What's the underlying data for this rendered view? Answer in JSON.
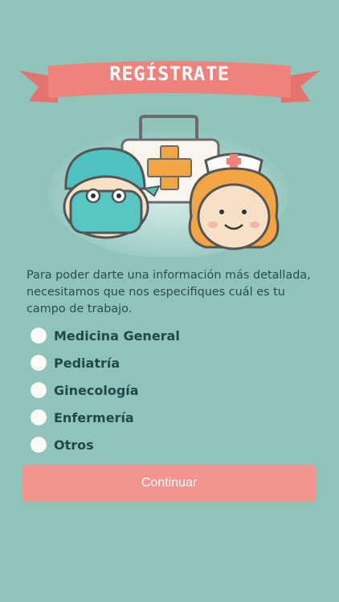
{
  "header": {
    "title": "REGÍSTRATE"
  },
  "intro_text": "Para poder darte una información más detallada, necesitamos que nos especifiques cuál es tu campo de trabajo.",
  "options": [
    {
      "label": "Medicina General"
    },
    {
      "label": "Pediatría"
    },
    {
      "label": "Ginecología"
    },
    {
      "label": "Enfermería"
    },
    {
      "label": "Otros"
    }
  ],
  "continue_button": {
    "label": "Continuar"
  },
  "colors": {
    "background": "#8fc4bb",
    "banner": "#f0827d",
    "button": "#f2958d",
    "text": "#2b4b53"
  },
  "icons": {
    "illustration": "medical-staff-illustration",
    "kit": "first-aid-kit-icon",
    "doctor": "surgeon-icon",
    "nurse": "nurse-icon"
  }
}
